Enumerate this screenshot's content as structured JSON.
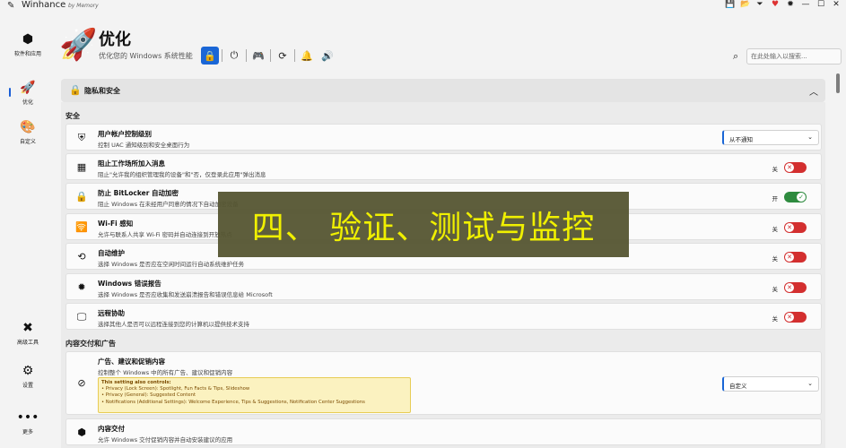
{
  "window": {
    "app_icon": "pencil-icon",
    "title": "Winhance",
    "subtitle": "by Memory",
    "controls": [
      {
        "name": "save-icon",
        "glyph": "💾"
      },
      {
        "name": "folder-icon",
        "glyph": "📂"
      },
      {
        "name": "filter-icon",
        "glyph": "⏷"
      },
      {
        "name": "heart-icon",
        "glyph": "♥"
      },
      {
        "name": "bug-icon",
        "glyph": "✹"
      },
      {
        "name": "minimize-icon",
        "glyph": "—"
      },
      {
        "name": "maximize-icon",
        "glyph": "☐"
      },
      {
        "name": "close-icon",
        "glyph": "✕"
      }
    ]
  },
  "sidebar": {
    "items": [
      {
        "label": "软件和应用",
        "icon": "package-icon",
        "glyph": "⬢"
      },
      {
        "label": "优化",
        "icon": "rocket-icon",
        "glyph": "🚀",
        "active": true
      },
      {
        "label": "自定义",
        "icon": "palette-icon",
        "glyph": "🎨"
      },
      {
        "label": "高级工具",
        "icon": "tools-icon",
        "glyph": "✖"
      },
      {
        "label": "设置",
        "icon": "gear-icon",
        "glyph": "⚙"
      },
      {
        "label": "更多",
        "icon": "more-icon",
        "glyph": "•••"
      }
    ]
  },
  "header": {
    "title": "优化",
    "subtitle": "优化您的 Windows 系统性能",
    "category_icons": [
      "lock-icon",
      "power-icon",
      "gamepad-icon",
      "refresh-icon",
      "notification-icon",
      "volume-icon"
    ],
    "search_placeholder": "在此处输入以搜索..."
  },
  "section": {
    "title": "隐私和安全",
    "icon": "lock-icon"
  },
  "groups": [
    {
      "label": "安全"
    },
    {
      "label": "内容交付和广告"
    }
  ],
  "settings": [
    {
      "icon": "shield-icon",
      "glyph": "⛨",
      "title": "用户帐户控制级别",
      "desc": "控制 UAC 通知级别和安全桌面行为",
      "control": "dropdown",
      "value": "从不通知"
    },
    {
      "icon": "building-icon",
      "glyph": "▦",
      "title": "阻止工作场所加入消息",
      "desc": "阻止\"允许我的组织管理我的设备\"和\"否，仅登录此应用\"弹出消息",
      "control": "toggle",
      "state": "关",
      "on": false
    },
    {
      "icon": "lock-icon",
      "glyph": "🔒",
      "title": "防止 BitLocker 自动加密",
      "desc": "阻止 Windows 在未经用户同意的情况下自动加密设备",
      "control": "toggle",
      "state": "开",
      "on": true
    },
    {
      "icon": "wifi-icon",
      "glyph": "🛜",
      "title": "Wi-Fi 感知",
      "desc": "允许与联系人共享 Wi-Fi 密码并自动连接到开放热点",
      "control": "toggle",
      "state": "关",
      "on": false
    },
    {
      "icon": "maintenance-icon",
      "glyph": "⟲",
      "title": "自动维护",
      "desc": "选择 Windows 是否应在空闲时间运行自动系统维护任务",
      "control": "toggle",
      "state": "关",
      "on": false
    },
    {
      "icon": "bug-icon",
      "glyph": "✹",
      "title": "Windows 错误报告",
      "desc": "选择 Windows 是否应收集和发送崩溃报告和错误信息给 Microsoft",
      "control": "toggle",
      "state": "关",
      "on": false
    },
    {
      "icon": "remote-icon",
      "glyph": "🖵",
      "title": "远程协助",
      "desc": "选择其他人是否可以远程连接到您的计算机以提供技术支持",
      "control": "toggle",
      "state": "关",
      "on": false
    }
  ],
  "ads": {
    "icon": "no-ads-icon",
    "glyph": "⊘",
    "title": "广告、建议和促销内容",
    "desc": "控制整个 Windows 中的所有广告、建议和促销内容",
    "value": "自定义",
    "note_head": "This setting also controls:",
    "note_lines": [
      "• Privacy (Lock Screen): Spotlight, Fun Facts & Tips, Slideshow",
      "• Privacy (General): Suggested Content",
      "• Notifications (Additional Settings): Welcome Experience, Tips & Suggestions, Notification Center Suggestions"
    ]
  },
  "content_delivery": {
    "icon": "package-icon",
    "glyph": "⬢",
    "title": "内容交付",
    "desc": "允许 Windows 交付促销内容并自动安装建议的应用"
  },
  "overlay": {
    "text": "四、 验证、测试与监控"
  },
  "colors": {
    "accent": "#1a66d6",
    "toggle_off": "#d32f2f",
    "toggle_on": "#2e8b3f",
    "overlay_bg": "#555532",
    "overlay_text": "#f0f000"
  }
}
